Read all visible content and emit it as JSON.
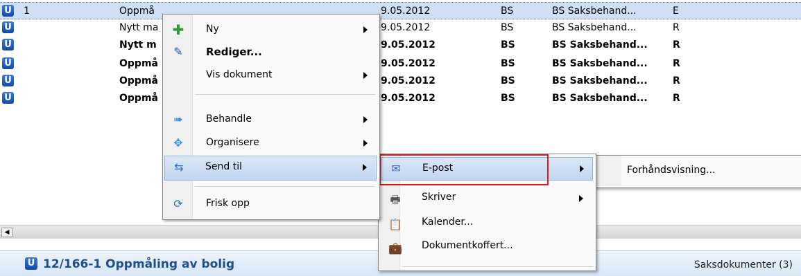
{
  "rows": [
    {
      "num": "1",
      "title": "Oppmå",
      "date": "9.05.2012",
      "code": "BS",
      "handler": "BS Saksbehand...",
      "status": "E",
      "bold": false,
      "selected": true
    },
    {
      "num": "",
      "title": "Nytt ma",
      "date": "9.05.2012",
      "code": "BS",
      "handler": "BS Saksbehand...",
      "status": "R",
      "bold": false,
      "selected": false
    },
    {
      "num": "",
      "title": "Nytt m",
      "date": "9.05.2012",
      "code": "BS",
      "handler": "BS Saksbehand...",
      "status": "R",
      "bold": true,
      "selected": false
    },
    {
      "num": "",
      "title": "Oppmå",
      "date": "9.05.2012",
      "code": "BS",
      "handler": "BS Saksbehand...",
      "status": "R",
      "bold": true,
      "selected": false
    },
    {
      "num": "",
      "title": "Oppmå",
      "date": "9.05.2012",
      "code": "BS",
      "handler": "BS Saksbehand...",
      "status": "R",
      "bold": true,
      "selected": false
    },
    {
      "num": "",
      "title": "Oppmå",
      "date": "9.05.2012",
      "code": "BS",
      "handler": "BS Saksbehand...",
      "status": "R",
      "bold": true,
      "selected": false
    }
  ],
  "row_badge": "U",
  "context_menu": {
    "items": [
      {
        "label": "Ny",
        "icon": "plus-icon",
        "bold": false,
        "submenu": true
      },
      {
        "label": "Rediger...",
        "icon": "pencil-icon",
        "bold": true,
        "submenu": false
      },
      {
        "label": "Vis dokument",
        "icon": "",
        "bold": false,
        "submenu": true
      },
      {
        "label": "Behandle",
        "icon": "arrow-icon",
        "bold": false,
        "submenu": true
      },
      {
        "label": "Organisere",
        "icon": "move-icon",
        "bold": false,
        "submenu": true
      },
      {
        "label": "Send til",
        "icon": "send-icon",
        "bold": false,
        "submenu": true
      },
      {
        "label": "Frisk opp",
        "icon": "refresh-icon",
        "bold": false,
        "submenu": false
      }
    ]
  },
  "send_submenu": {
    "items": [
      {
        "label": "E-post",
        "icon": "mail-icon",
        "submenu": true
      },
      {
        "label": "Skriver",
        "icon": "printer-icon",
        "submenu": true
      },
      {
        "label": "Kalender...",
        "icon": "calendar-icon",
        "submenu": false
      },
      {
        "label": "Dokumentkoffert...",
        "icon": "briefcase-icon",
        "submenu": false
      }
    ]
  },
  "email_submenu": {
    "items": [
      {
        "label": "Forhåndsvisning..."
      }
    ]
  },
  "bottom": {
    "badge": "U",
    "title": "12/166-1 Oppmåling av bolig",
    "right": "Saksdokumenter (3)"
  },
  "colors": {
    "selection": "#cfe0f4",
    "highlight_border": "#e01a1a",
    "title": "#1f4f8c"
  }
}
